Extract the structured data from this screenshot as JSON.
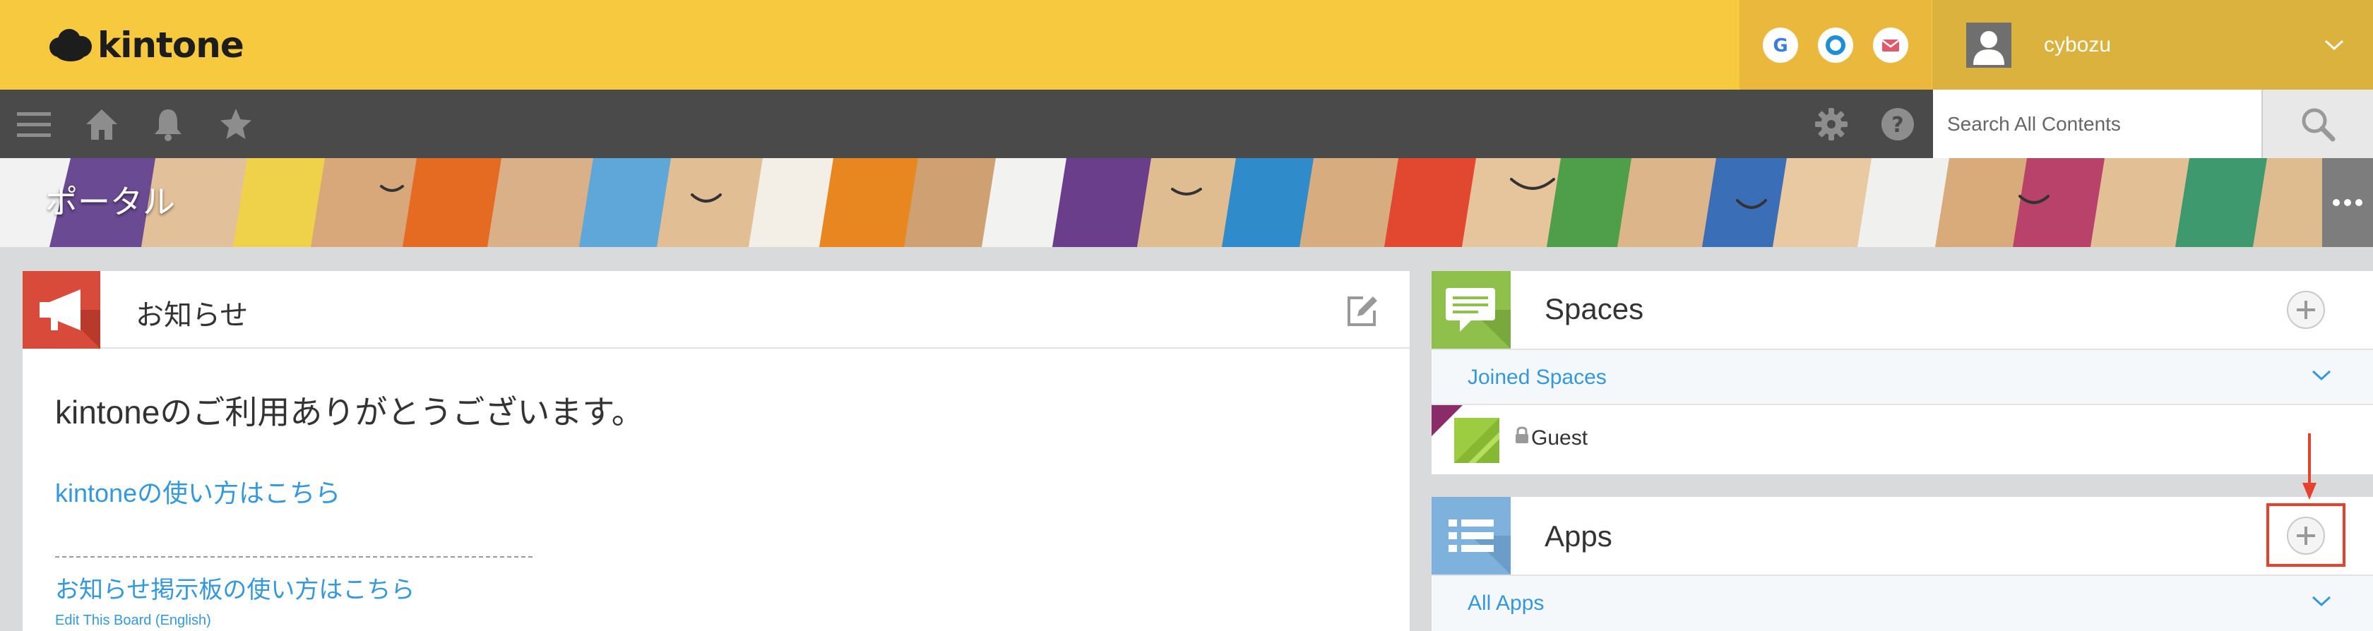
{
  "header": {
    "logo_text": "kintone",
    "user_name": "cybozu"
  },
  "nav": {
    "search_placeholder": "Search All Contents"
  },
  "banner": {
    "title": "ポータル"
  },
  "notice": {
    "title": "お知らせ",
    "welcome": "kintoneのご利用ありがとうございます。",
    "link_howto": "kintoneの使い方はこちら",
    "link_board_howto": "お知らせ掲示板の使い方はこちら",
    "link_edit_board": "Edit This Board (English)"
  },
  "spaces": {
    "title": "Spaces",
    "filter_label": "Joined Spaces",
    "items": [
      {
        "name": "Guest"
      }
    ]
  },
  "apps": {
    "title": "Apps",
    "filter_label": "All Apps"
  },
  "colors": {
    "header_yellow": "#f7c93f",
    "nav_dark": "#4a4a4a",
    "notice_red": "#d84b3a",
    "spaces_green": "#8fc04b",
    "apps_blue": "#7eb2dd",
    "link_blue": "#3498db",
    "highlight_red": "#e5412d"
  },
  "icons": [
    "menu-icon",
    "home-icon",
    "bell-icon",
    "star-icon",
    "gear-icon",
    "help-icon",
    "search-icon",
    "google-icon",
    "outlook-icon",
    "mail-icon",
    "megaphone-icon",
    "edit-icon",
    "chat-icon",
    "list-icon",
    "lock-icon",
    "plus-icon",
    "chevron-down-icon"
  ]
}
